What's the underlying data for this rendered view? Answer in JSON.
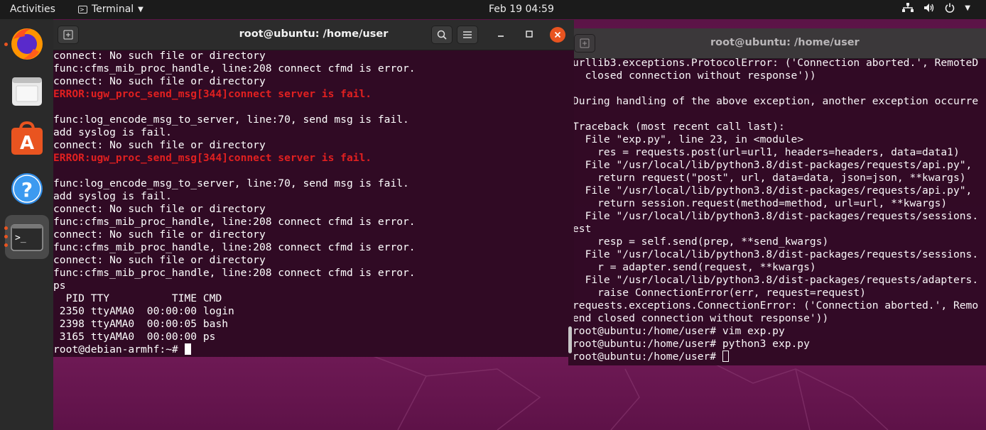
{
  "topbar": {
    "activities": "Activities",
    "app_name": "Terminal",
    "clock": "Feb 19  04:59"
  },
  "dock": {
    "items": [
      "firefox-icon",
      "files-icon",
      "software-icon",
      "help-icon",
      "terminal-icon"
    ]
  },
  "terminal_front": {
    "title": "root@ubuntu: /home/user",
    "lines": [
      {
        "text": "connect: No such file or directory",
        "error": false
      },
      {
        "text": "func:cfms_mib_proc_handle, line:208 connect cfmd is error.",
        "error": false
      },
      {
        "text": "connect: No such file or directory",
        "error": false
      },
      {
        "text": "ERROR:ugw_proc_send_msg[344]connect server is fail.",
        "error": true
      },
      {
        "text": "",
        "error": false
      },
      {
        "text": "func:log_encode_msg_to_server, line:70, send msg is fail.",
        "error": false
      },
      {
        "text": "add syslog is fail.",
        "error": false
      },
      {
        "text": "connect: No such file or directory",
        "error": false
      },
      {
        "text": "ERROR:ugw_proc_send_msg[344]connect server is fail.",
        "error": true
      },
      {
        "text": "",
        "error": false
      },
      {
        "text": "func:log_encode_msg_to_server, line:70, send msg is fail.",
        "error": false
      },
      {
        "text": "add syslog is fail.",
        "error": false
      },
      {
        "text": "connect: No such file or directory",
        "error": false
      },
      {
        "text": "func:cfms_mib_proc_handle, line:208 connect cfmd is error.",
        "error": false
      },
      {
        "text": "connect: No such file or directory",
        "error": false
      },
      {
        "text": "func:cfms_mib_proc_handle, line:208 connect cfmd is error.",
        "error": false
      },
      {
        "text": "connect: No such file or directory",
        "error": false
      },
      {
        "text": "func:cfms_mib_proc_handle, line:208 connect cfmd is error.",
        "error": false
      },
      {
        "text": "ps",
        "error": false
      },
      {
        "text": "  PID TTY          TIME CMD",
        "error": false
      },
      {
        "text": " 2350 ttyAMA0  00:00:00 login",
        "error": false
      },
      {
        "text": " 2398 ttyAMA0  00:00:05 bash",
        "error": false
      },
      {
        "text": " 3165 ttyAMA0  00:00:00 ps",
        "error": false
      }
    ],
    "prompt": "root@debian-armhf:~# "
  },
  "terminal_back": {
    "title": "root@ubuntu: /home/user",
    "lines": [
      "urllib3.exceptions.ProtocolError: ('Connection aborted.', RemoteD",
      "  closed connection without response'))",
      "",
      "During handling of the above exception, another exception occurre",
      "",
      "Traceback (most recent call last):",
      "  File \"exp.py\", line 23, in <module>",
      "    res = requests.post(url=url1, headers=headers, data=data1)",
      "  File \"/usr/local/lib/python3.8/dist-packages/requests/api.py\",",
      "    return request(\"post\", url, data=data, json=json, **kwargs)",
      "  File \"/usr/local/lib/python3.8/dist-packages/requests/api.py\",",
      "    return session.request(method=method, url=url, **kwargs)",
      "  File \"/usr/local/lib/python3.8/dist-packages/requests/sessions.",
      "est",
      "    resp = self.send(prep, **send_kwargs)",
      "  File \"/usr/local/lib/python3.8/dist-packages/requests/sessions.",
      "    r = adapter.send(request, **kwargs)",
      "  File \"/usr/local/lib/python3.8/dist-packages/requests/adapters.",
      "    raise ConnectionError(err, request=request)",
      "requests.exceptions.ConnectionError: ('Connection aborted.', Remo",
      "end closed connection without response'))",
      "root@ubuntu:/home/user# vim exp.py",
      "root@ubuntu:/home/user# python3 exp.py"
    ],
    "prompt": "root@ubuntu:/home/user# "
  },
  "colors": {
    "terminal_bg": "#300a24",
    "error_text": "#e02020",
    "close_button": "#e95420"
  }
}
